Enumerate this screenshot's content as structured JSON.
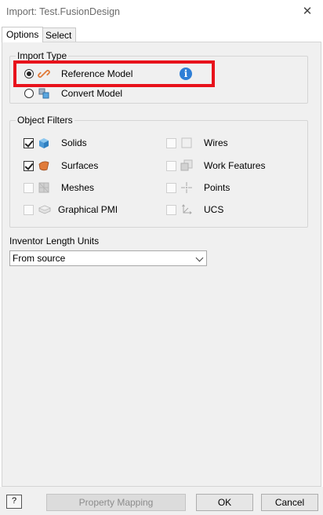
{
  "window": {
    "title": "Import:  Test.FusionDesign"
  },
  "tabs": [
    {
      "label": "Options",
      "active": true
    },
    {
      "label": "Select",
      "active": false
    }
  ],
  "import_type": {
    "legend": "Import Type",
    "options": [
      {
        "label": "Reference Model",
        "selected": true,
        "icon": "reference-link-icon"
      },
      {
        "label": "Convert Model",
        "selected": false,
        "icon": "convert-model-icon"
      }
    ],
    "info_icon": "info-icon",
    "highlight_color": "#e8121b"
  },
  "object_filters": {
    "legend": "Object Filters",
    "left": [
      {
        "label": "Solids",
        "checked": true,
        "enabled": true,
        "icon": "solid-cube-icon"
      },
      {
        "label": "Surfaces",
        "checked": true,
        "enabled": true,
        "icon": "surface-icon"
      },
      {
        "label": "Meshes",
        "checked": false,
        "enabled": false,
        "icon": "mesh-icon"
      },
      {
        "label": "Graphical PMI",
        "checked": false,
        "enabled": false,
        "icon": "pmi-icon"
      }
    ],
    "right": [
      {
        "label": "Wires",
        "checked": false,
        "enabled": false,
        "icon": "wire-icon"
      },
      {
        "label": "Work Features",
        "checked": false,
        "enabled": false,
        "icon": "work-features-icon"
      },
      {
        "label": "Points",
        "checked": false,
        "enabled": false,
        "icon": "point-icon"
      },
      {
        "label": "UCS",
        "checked": false,
        "enabled": false,
        "icon": "ucs-icon"
      }
    ]
  },
  "length_units": {
    "label": "Inventor Length Units",
    "value": "From source"
  },
  "footer": {
    "property_mapping": "Property Mapping",
    "ok": "OK",
    "cancel": "Cancel",
    "help_icon": "help-icon"
  },
  "colors": {
    "accent_blue": "#2f7fd6",
    "solid_blue": "#5aa7e0",
    "surface_orange": "#e07b3a"
  }
}
